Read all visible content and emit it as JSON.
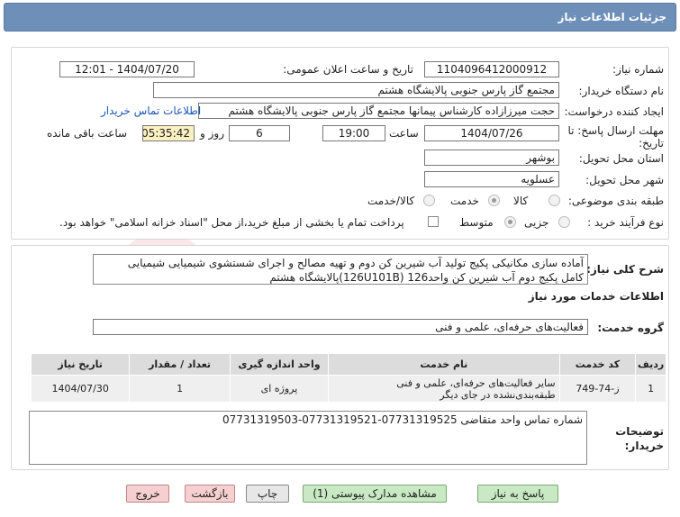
{
  "window": {
    "title": "جزئیات اطلاعات نیاز"
  },
  "form": {
    "need_number_label": "شماره نیاز:",
    "need_number": "1104096412000912",
    "announce_label": "تاریخ و ساعت اعلان عمومی:",
    "announce_value": "1404/07/20 - 12:01",
    "buyer_label": "نام دستگاه خریدار:",
    "buyer": "مجتمع گاز پارس جنوبی  پالایشگاه هشتم",
    "creator_label": "ایجاد کننده درخواست:",
    "creator": "حجت میرزازاده کارشناس پیمانها مجتمع گاز پارس جنوبی  پالایشگاه هشتم",
    "contact_link": "اطلاعات تماس خریدار",
    "deadline_label_1": "مهلت ارسال پاسخ: تا",
    "deadline_label_2": "تاریخ:",
    "deadline_date": "1404/07/26",
    "time_label": "ساعت",
    "deadline_time": "19:00",
    "days_value": "6",
    "days_label": "روز و",
    "remaining_time": "05:35:42",
    "remaining_label": "ساعت باقی مانده",
    "province_label": "استان محل تحویل:",
    "province": "بوشهر",
    "city_label": "شهر محل تحویل:",
    "city": "عسلویه",
    "category_label": "طبقه بندی موضوعی:",
    "category_options": [
      "کالا",
      "خدمت",
      "کالا/خدمت"
    ],
    "category_selected": "خدمت",
    "process_label": "نوع فرآیند خرید :",
    "process_options": [
      "جزیی",
      "متوسط"
    ],
    "process_selected": "متوسط",
    "payment_note": "پرداخت تمام یا بخشی از مبلغ خرید،از محل \"اسناد خزانه اسلامی\" خواهد بود."
  },
  "need": {
    "summary_label": "شرح کلی نیاز:",
    "summary_line1": "آماده سازی مکانیکی پکیج تولید آب شیرین کن دوم و تهیه مصالح و اجرای شستشوی شیمیایی شیمیایی",
    "summary_line2": "کامل پکیج دوم آب شیرین کن واحد126 (126U101B)پالایشگاه هشتم",
    "services_heading": "اطلاعات خدمات مورد نیاز",
    "service_group_label": "گروه خدمت:",
    "service_group": "فعالیت‌های حرفه‌ای، علمی و فنی"
  },
  "table": {
    "headers": [
      "ردیف",
      "کد خدمت",
      "نام خدمت",
      "واحد اندازه گیری",
      "تعداد / مقدار",
      "تاریخ نیاز"
    ],
    "rows": [
      [
        "1",
        "ز-74-749",
        "سایر فعالیت‌های حرفه‌ای، علمی و فنی طبقه‌بندی‌نشده در جای دیگر",
        "پروژه ای",
        "1",
        "1404/07/30"
      ]
    ]
  },
  "buyer_notes": {
    "label_1": "توضیحات",
    "label_2": "خریدار:",
    "text": "شماره تماس واحد متقاضی 07731319525-07731319521-07731319503"
  },
  "buttons": {
    "reply": "پاسخ به نیاز",
    "attachments": "مشاهده مدارک پیوستی (1)",
    "print": "چاپ",
    "back": "بازگشت",
    "exit": "خروج"
  },
  "watermark": "AriaTender.net"
}
